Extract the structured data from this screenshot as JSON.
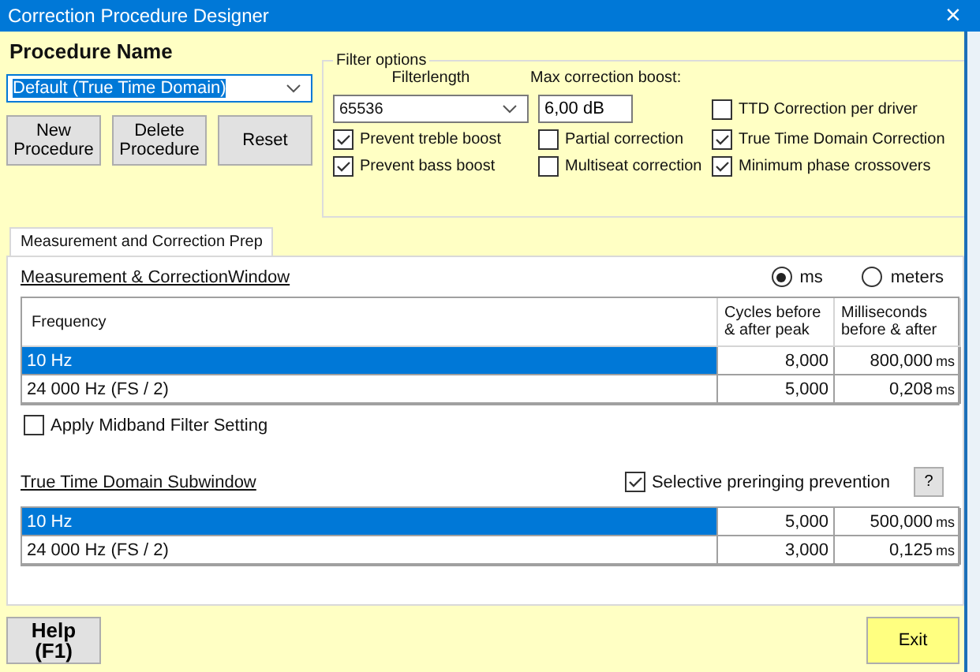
{
  "window": {
    "title": "Correction Procedure Designer",
    "close": "×"
  },
  "procedure": {
    "label": "Procedure Name",
    "value": "Default (True Time Domain)",
    "buttons": [
      "New Procedure",
      "Delete Procedure",
      "Reset"
    ]
  },
  "filter_options": {
    "title": "Filter options",
    "filterlength_label": "Filterlength",
    "filterlength": "65536",
    "boost_label": "Max correction boost:",
    "boost": "6,00 dB",
    "checkboxes": [
      {
        "label": "TTD Correction per driver",
        "checked": false
      },
      {
        "label": "Prevent treble boost",
        "checked": true
      },
      {
        "label": "Partial correction",
        "checked": false
      },
      {
        "label": "True Time Domain Correction",
        "checked": true
      },
      {
        "label": "Prevent bass boost",
        "checked": true
      },
      {
        "label": "Multiseat correction",
        "checked": false
      },
      {
        "label": "Minimum phase crossovers",
        "checked": true
      }
    ]
  },
  "tabs": [
    {
      "label": "Measurement and Correction Prep",
      "selected": true
    }
  ],
  "measurement": {
    "title": "Measurement & CorrectionWindow",
    "units": [
      {
        "label": "ms",
        "selected": true
      },
      {
        "label": "meters",
        "selected": false
      }
    ],
    "columns": [
      "Frequency",
      "Cycles before & after peak",
      "Milliseconds before & after"
    ],
    "rows": [
      {
        "frequency": "10 Hz",
        "cycles": "8,000",
        "milliseconds": "800,000",
        "unit": "ms",
        "selected": true
      },
      {
        "frequency": "24 000 Hz (FS / 2)",
        "cycles": "5,000",
        "milliseconds": "0,208",
        "unit": "ms",
        "selected": false
      }
    ],
    "midband": {
      "label": "Apply Midband Filter Setting",
      "checked": false
    }
  },
  "subwindow": {
    "title": "True Time Domain Subwindow",
    "preringing": {
      "label": "Selective preringing prevention",
      "checked": true
    },
    "help": "?",
    "rows": [
      {
        "frequency": "10 Hz",
        "cycles": "5,000",
        "milliseconds": "500,000",
        "unit": "ms",
        "selected": true
      },
      {
        "frequency": "24 000 Hz (FS / 2)",
        "cycles": "3,000",
        "milliseconds": "0,125",
        "unit": "ms",
        "selected": false
      }
    ]
  },
  "footer": {
    "help": "Help\n(F1)",
    "exit": "Exit"
  }
}
